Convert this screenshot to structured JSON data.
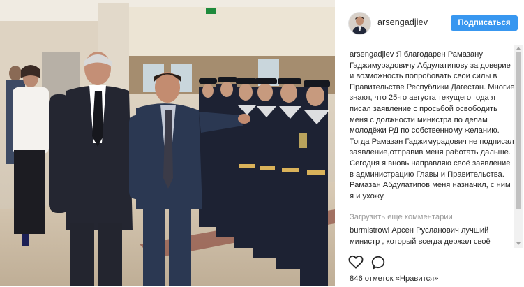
{
  "post": {
    "username": "arsengadjiev",
    "follow_label": "Подписаться",
    "caption_username": "arsengadjiev",
    "caption_text": "Я благодарен Рамазану Гаджимурадовичу Абдулатипову за доверие и возможность попробовать свои силы в Правительстве Республики Дагестан. Многие знают, что 25-го августа текущего года я писал заявление с просьбой освободить меня с должности министра по делам молодёжи РД по собственному желанию. Тогда Рамазан Гаджимурадович не подписал заявление,отправив меня работать дальше. Сегодня я вновь направляю своё заявление в администрацию Главы и Правительства. Рамазан Абдулатипов меня назначил, с ним я и ухожу.",
    "load_more_label": "Загрузить еще комментарии",
    "comment": {
      "username": "burmistrowi",
      "text": "Арсен Русланович лучший министр , который всегда держал своё"
    },
    "likes_text": "846 отметок «Нравится»"
  },
  "icons": {
    "like": "heart-outline-icon",
    "comment": "speech-bubble-icon"
  },
  "colors": {
    "follow_button": "#3897f0",
    "text": "#262626",
    "muted": "#999999"
  }
}
